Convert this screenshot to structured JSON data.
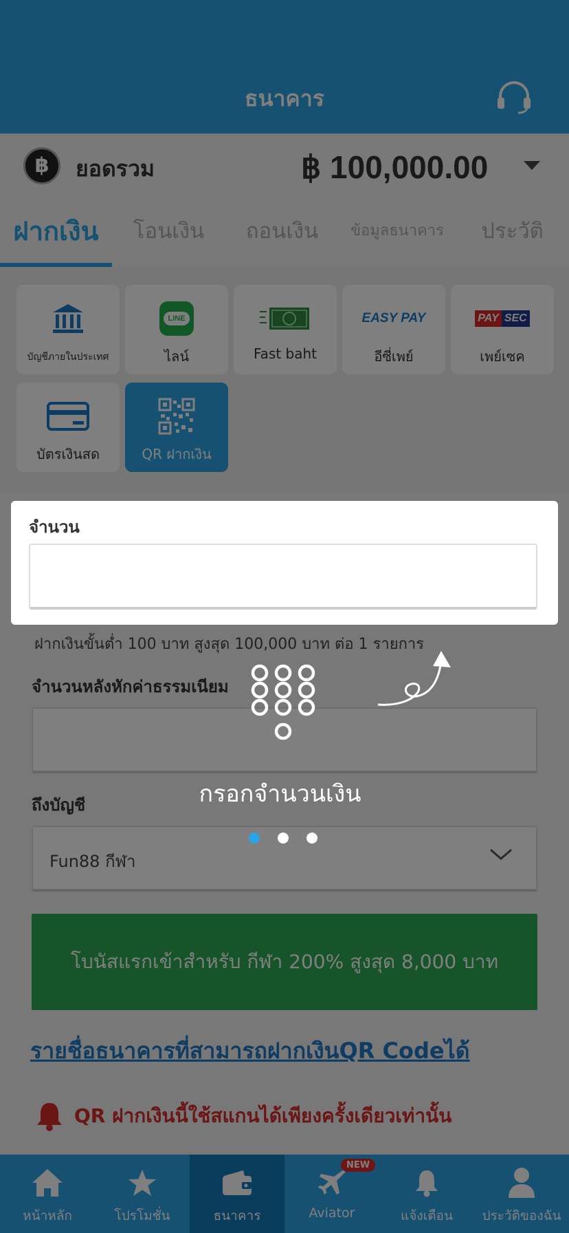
{
  "header": {
    "title": "ธนาคาร",
    "support_icon": "headset-icon"
  },
  "balance": {
    "currency_symbol": "฿",
    "label": "ยอดรวม",
    "amount": "฿ 100,000.00"
  },
  "tabs": [
    {
      "label": "ฝากเงิน",
      "active": true
    },
    {
      "label": "โอนเงิน"
    },
    {
      "label": "ถอนเงิน"
    },
    {
      "label": "ข้อมูลธนาคาร"
    },
    {
      "label": "ประวัติ"
    }
  ],
  "methods": [
    {
      "label": "บัญชีภายในประเทศ",
      "icon": "bank-icon"
    },
    {
      "label": "ไลน์",
      "icon": "line-icon",
      "icon_text": "LINE"
    },
    {
      "label": "Fast baht",
      "icon": "baht-note-icon"
    },
    {
      "label": "อีซี่เพย์",
      "icon": "easypay-icon",
      "icon_text": "EASY PAY"
    },
    {
      "label": "เพย์เซค",
      "icon": "paysec-icon",
      "icon_text_a": "PAY",
      "icon_text_b": "SEC"
    },
    {
      "label": "บัตรเงินสด",
      "icon": "cash-card-icon"
    },
    {
      "label": "QR ฝากเงิน",
      "icon": "qr-code-icon",
      "active": true
    }
  ],
  "form": {
    "amount_label": "จำนวน",
    "amount_value": "",
    "limit_text": "ฝากเงินขั้นต่ำ 100 บาท สูงสุด 100,000 บาท ต่อ 1 รายการ",
    "fee_label": "จำนวนหลังหักค่าธรรมเนียม",
    "fee_value": "",
    "account_label": "ถึงบัญชี",
    "account_value": "Fun88 กีฬา"
  },
  "bonus_banner": "โบนัสแรกเข้าสำหรับ กีฬา 200% สูงสุด 8,000 บาท",
  "bank_list_link": "รายชื่อธนาคารที่สามารถฝากเงินQR Codeได้",
  "notice": "QR ฝากเงินนี้ใช้สแกนได้เพียงครั้งเดียวเท่านั้น",
  "tutorial": {
    "text": "กรอกจำนวนเงิน",
    "total_steps": 3,
    "current_step": 1
  },
  "bottom_nav": [
    {
      "label": "หน้าหลัก",
      "icon": "home-icon"
    },
    {
      "label": "โปรโมชั่น",
      "icon": "star-icon"
    },
    {
      "label": "ธนาคาร",
      "icon": "wallet-icon",
      "active": true
    },
    {
      "label": "Aviator",
      "icon": "plane-icon",
      "badge": "NEW"
    },
    {
      "label": "แจ้งเตือน",
      "icon": "bell-icon"
    },
    {
      "label": "ประวัติของฉัน",
      "icon": "user-icon"
    }
  ],
  "colors": {
    "primary": "#2da3e3",
    "bonus_green": "#2fa852",
    "link_blue": "#1f78c4",
    "alert_red": "#d62a2a",
    "badge_red": "#e02828"
  }
}
